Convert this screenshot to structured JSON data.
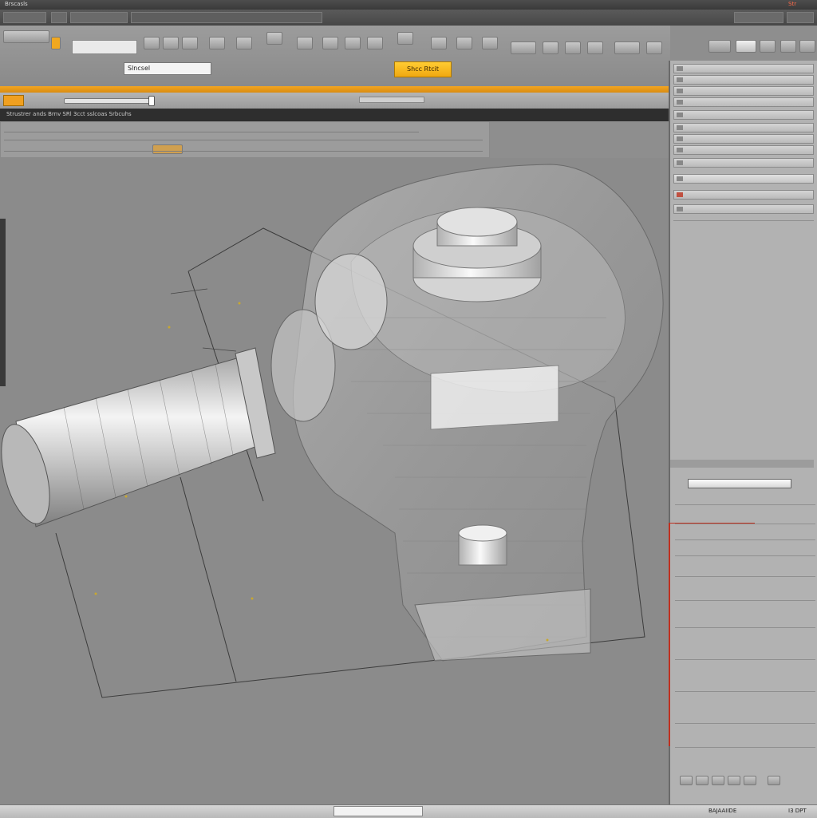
{
  "titlebar": {
    "left_text": "Brscasls",
    "right_text": "Str"
  },
  "toolbar": {
    "selection_label": "Slncsel",
    "action_button": "Shcc Rtcit"
  },
  "viewport": {
    "header_text": "Strustrer ands Brnv SRl 3cct sslcoas Srbcuhs"
  },
  "statusbar": {
    "right_text": "BAJAAIIDE",
    "far_right": "I3 DPT"
  },
  "colors": {
    "accent": "#f0a820",
    "viewport_bg": "#8b8b8b",
    "panel_bg": "#b2b2b2"
  },
  "icons": [
    "close-icon",
    "gear-icon",
    "folder-icon",
    "eye-icon",
    "layer-icon"
  ]
}
